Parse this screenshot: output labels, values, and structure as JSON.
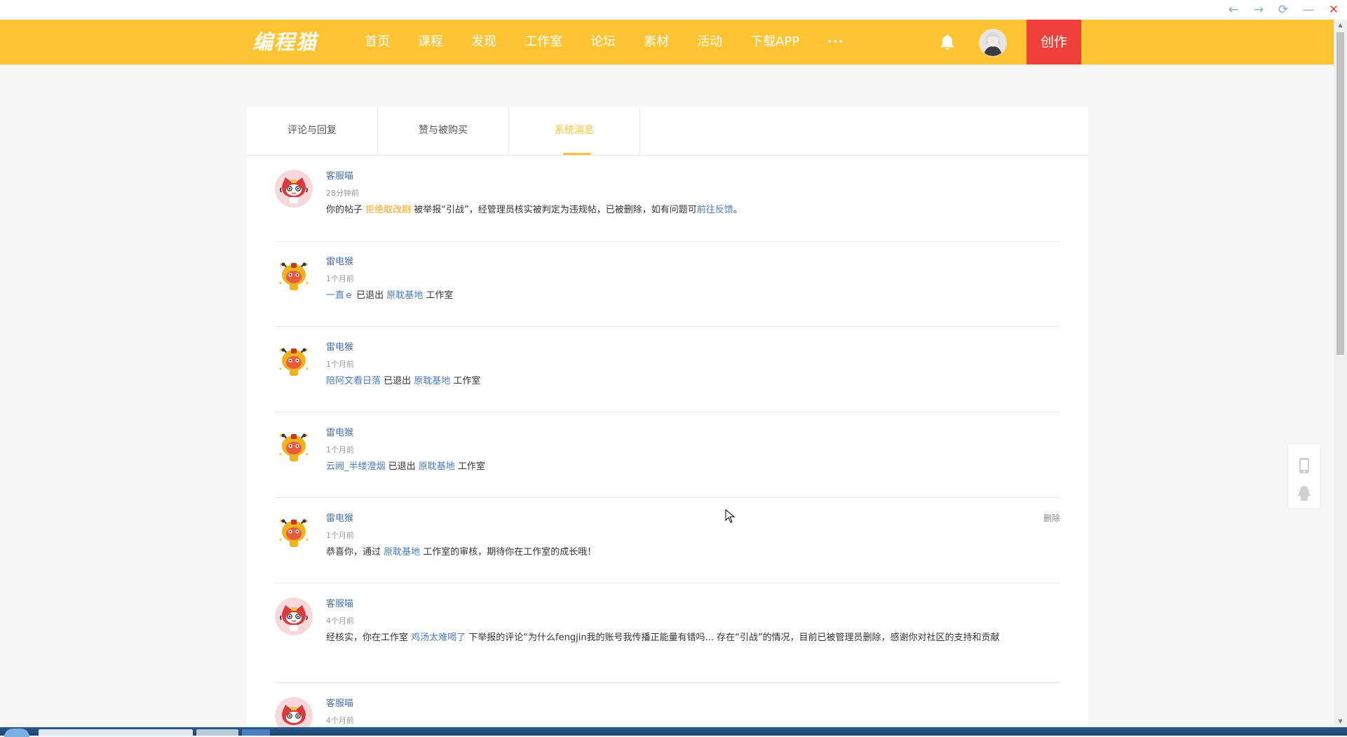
{
  "window": {
    "controls": [
      "←",
      "→",
      "⟳",
      "—",
      "✕"
    ]
  },
  "header": {
    "logo": "编程猫",
    "nav": [
      "首页",
      "课程",
      "发现",
      "工作室",
      "论坛",
      "素材",
      "活动",
      "下载APP",
      "···"
    ],
    "create_label": "创作",
    "bell_icon": "bell-icon",
    "brand_color": "#fec433",
    "create_color": "#f1403c"
  },
  "tabs": [
    {
      "label": "评论与回复",
      "active": false
    },
    {
      "label": "赞与被购买",
      "active": false
    },
    {
      "label": "系统消息",
      "active": true
    }
  ],
  "messages": [
    {
      "name": "客服喵",
      "time": "28分钟前",
      "avatar": "kefu",
      "body": {
        "p1": "你的帖子 ",
        "l1": "拒绝取改剧",
        "p2": " 被举报“引战”，经管理员核实被判定为违规帖，已被删除，如有问题可",
        "l2": "前往反馈",
        "p3": "。"
      }
    },
    {
      "name": "雷电猴",
      "time": "1个月前",
      "avatar": "leidian",
      "body": {
        "l1": " 一直ｅ ",
        "p1": " 已退出 ",
        "l2": "原耽基地",
        "p2": " 工作室"
      }
    },
    {
      "name": "雷电猴",
      "time": "1个月前",
      "avatar": "leidian",
      "body": {
        "l1": " 陪阿文看日落",
        "p1": " 已退出 ",
        "l2": "原耽基地",
        "p2": " 工作室"
      }
    },
    {
      "name": "雷电猴",
      "time": "1个月前",
      "avatar": "leidian",
      "body": {
        "l1": " 云阙_半缕澄烟",
        "p1": " 已退出 ",
        "l2": "原耽基地",
        "p2": " 工作室"
      }
    },
    {
      "name": "雷电猴",
      "time": "1个月前",
      "avatar": "leidian",
      "delete_label": "删除",
      "body": {
        "p1": "恭喜你，通过 ",
        "l1": "原耽基地",
        "p2": " 工作室的审核，期待你在工作室的成长哦！"
      }
    },
    {
      "name": "客服喵",
      "time": "4个月前",
      "avatar": "kefu",
      "body": {
        "p1": "经核实，你在工作室 ",
        "l1": "鸡汤太难喝了",
        "p2": " 下举报的评论“为什么fengjin我的账号我传播正能量有错吗... 存在“引战”的情况，目前已被管理员删除，感谢你对社区的支持和贡献"
      }
    },
    {
      "name": "客服喵",
      "time": "4个月前",
      "avatar": "kefu"
    }
  ],
  "side": {
    "icons": [
      "tablet-icon",
      "qq-penguin-icon"
    ]
  }
}
